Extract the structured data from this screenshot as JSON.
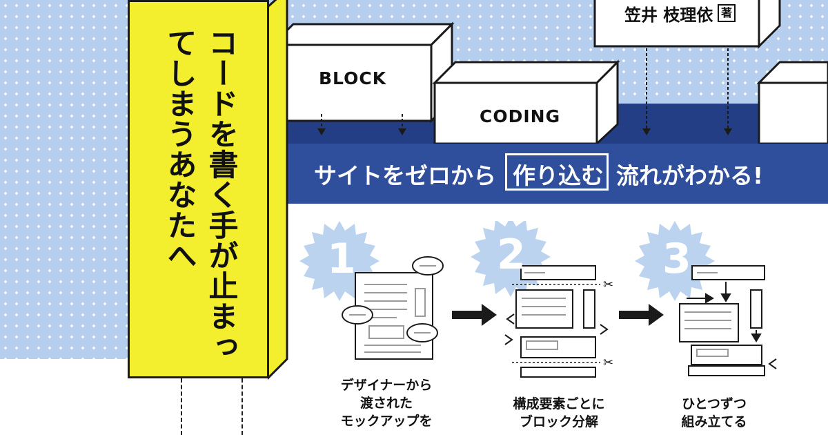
{
  "tower": {
    "title": "コードを書く手が止まってしまうあなたへ"
  },
  "banner": {
    "text_before": "サイトをゼロから",
    "text_boxed": "作り込む",
    "text_after": "流れがわかる!"
  },
  "blocks": {
    "block_label": "BLOCK",
    "coding_label": "CODING"
  },
  "author": {
    "name": "笠井 枝理依",
    "mark": "著"
  },
  "steps": [
    {
      "number": "1",
      "caption_lines": [
        "デザイナーから",
        "渡された",
        "モックアップを"
      ]
    },
    {
      "number": "2",
      "caption_lines": [
        "構成要素ごとに",
        "ブロック分解"
      ]
    },
    {
      "number": "3",
      "caption_lines": [
        "ひとつずつ",
        "組み立てる"
      ]
    }
  ],
  "colors": {
    "background_blue": "#b7cfee",
    "tower_yellow": "#f3ee2e",
    "banner_blue": "#2f4f9c",
    "badge_blue": "#bcd3ef"
  }
}
